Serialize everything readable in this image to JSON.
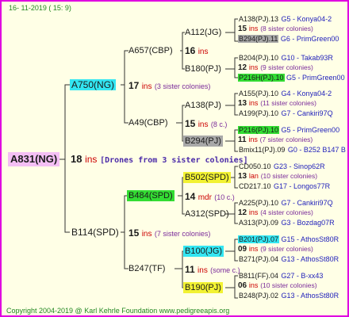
{
  "date": "16- 11-2019 ( 15:  9)",
  "copyright": "Copyright 2004-2019 @ Karl Kehrle Foundation   www.pedigreeapis.org",
  "root": {
    "label": "A831(NG)",
    "ins": "18",
    "ins_word": "ins",
    "drones": "[Drones from 3 sister colonies]"
  },
  "gen1": [
    {
      "label": "A750(NG)",
      "ins": "17",
      "ins_word": "ins",
      "note": "(3 sister colonies)"
    },
    {
      "label": "B114(SPD)",
      "ins": "15",
      "ins_word": "ins",
      "note": "(7 sister colonies)"
    }
  ],
  "gen2": [
    {
      "label": "A657(CBP)",
      "ins": "16",
      "ins_word": "ins",
      "note": ""
    },
    {
      "label": "A49(CBP)",
      "ins": "15",
      "ins_word": "ins",
      "note": "(8 c.)"
    },
    {
      "label": "B484(SPD)",
      "ins": "14",
      "ins_word": "mdr",
      "note": "(10 c.)"
    },
    {
      "label": "B247(TF)",
      "ins": "11",
      "ins_word": "ins",
      "note": "(some c.)"
    }
  ],
  "gen3": [
    {
      "label": "A112(JG)"
    },
    {
      "label": "B180(PJ)"
    },
    {
      "label": "A138(PJ)"
    },
    {
      "label": "B294(PJ)"
    },
    {
      "label": "B502(SPD)"
    },
    {
      "label": "A312(SPD)"
    },
    {
      "label": "B100(JG)"
    },
    {
      "label": "B190(PJ)"
    }
  ],
  "gen4": [
    {
      "top": "A138(PJ).13",
      "top_info": "G5 - Konya04-2",
      "ins": "15",
      "ins_word": "ins",
      "note": "(8 sister colonies)",
      "bottom": "B294(PJ).11",
      "bottom_info": "G6 - PrimGreen00"
    },
    {
      "top": "B204(PJ).10",
      "top_info": "G10 - Takab93R",
      "ins": "12",
      "ins_word": "ins",
      "note": "(9 sister colonies)",
      "bottom": "P216H(PJ).10",
      "bottom_info": "G5 - PrimGreen00"
    },
    {
      "top": "A155(PJ).10",
      "top_info": "G4 - Konya04-2",
      "ins": "13",
      "ins_word": "ins",
      "note": "(11 sister colonies)",
      "bottom": "A199(PJ).10",
      "bottom_info": "G7 - Cankiri97Q"
    },
    {
      "top": "P216(PJ).10",
      "top_info": "G5 - PrimGreen00",
      "ins": "11",
      "ins_word": "ins",
      "note": "(7 sister colonies)",
      "bottom": "Bmix11(PJ).09",
      "bottom_info": "G0 - B252 B147 B"
    },
    {
      "top": "CD050.10",
      "top_info": "G23 - Sinop62R",
      "ins": "13",
      "ins_word": "lan",
      "note": "(10 sister colonies)",
      "bottom": "CD217.10",
      "bottom_info": "G17 - Longos77R"
    },
    {
      "top": "A225(PJ).10",
      "top_info": "G7 - Cankiri97Q",
      "ins": "12",
      "ins_word": "ins",
      "note": "(4 sister colonies)",
      "bottom": "A313(PJ).09",
      "bottom_info": "G3 - Bozdag07R"
    },
    {
      "top": "B201(PJ).07",
      "top_info": "G15 - AthosSt80R",
      "ins": "09",
      "ins_word": "ins",
      "note": "(9 sister colonies)",
      "bottom": "B271(PJ).04",
      "bottom_info": "G13 - AthosSt80R"
    },
    {
      "top": "B811(FF).04",
      "top_info": "G27 - B-xx43",
      "ins": "06",
      "ins_word": "ins",
      "note": "(10 sister colonies)",
      "bottom": "B248(PJ).02",
      "bottom_info": "G13 - AthosSt80R"
    }
  ]
}
